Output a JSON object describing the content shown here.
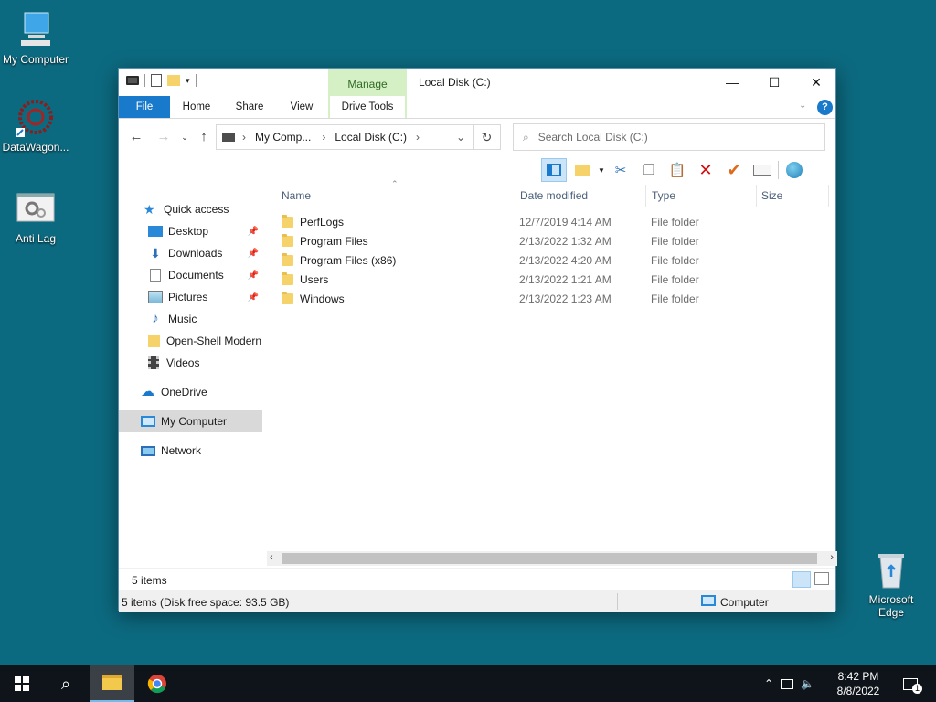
{
  "desktop": {
    "icons": [
      {
        "label": "My Computer"
      },
      {
        "label": "DataWagon..."
      },
      {
        "label": "Anti Lag"
      },
      {
        "label": "Microsoft Edge"
      }
    ]
  },
  "window": {
    "title": "Local Disk (C:)",
    "manage_tab": {
      "label": "Manage",
      "sub": "Drive Tools"
    },
    "ribbon_tabs": [
      "File",
      "Home",
      "Share",
      "View"
    ],
    "controls": {
      "minimize": "—",
      "maximize": "☐",
      "close": "✕"
    }
  },
  "address": {
    "segments": [
      "My Comp...",
      "Local Disk (C:)"
    ],
    "search_placeholder": "Search Local Disk (C:)"
  },
  "nav_pane": {
    "quick_access": "Quick access",
    "items": [
      "Desktop",
      "Downloads",
      "Documents",
      "Pictures",
      "Music",
      "Open-Shell Modern",
      "Videos"
    ],
    "onedrive": "OneDrive",
    "my_computer": "My Computer",
    "network": "Network"
  },
  "columns": {
    "name": "Name",
    "date": "Date modified",
    "type": "Type",
    "size": "Size"
  },
  "files": [
    {
      "name": "PerfLogs",
      "date": "12/7/2019 4:14 AM",
      "type": "File folder"
    },
    {
      "name": "Program Files",
      "date": "2/13/2022 1:32 AM",
      "type": "File folder"
    },
    {
      "name": "Program Files (x86)",
      "date": "2/13/2022 4:20 AM",
      "type": "File folder"
    },
    {
      "name": "Users",
      "date": "2/13/2022 1:21 AM",
      "type": "File folder"
    },
    {
      "name": "Windows",
      "date": "2/13/2022 1:23 AM",
      "type": "File folder"
    }
  ],
  "status": {
    "count": "5 items",
    "detail": "5 items (Disk free space: 93.5 GB)",
    "location": "Computer"
  },
  "taskbar": {
    "time": "8:42 PM",
    "date": "8/8/2022",
    "notification_count": "1"
  },
  "colors": {
    "accent": "#1979ca",
    "manage_bg": "#d5f0c4",
    "desktop": "#0c6a80"
  }
}
